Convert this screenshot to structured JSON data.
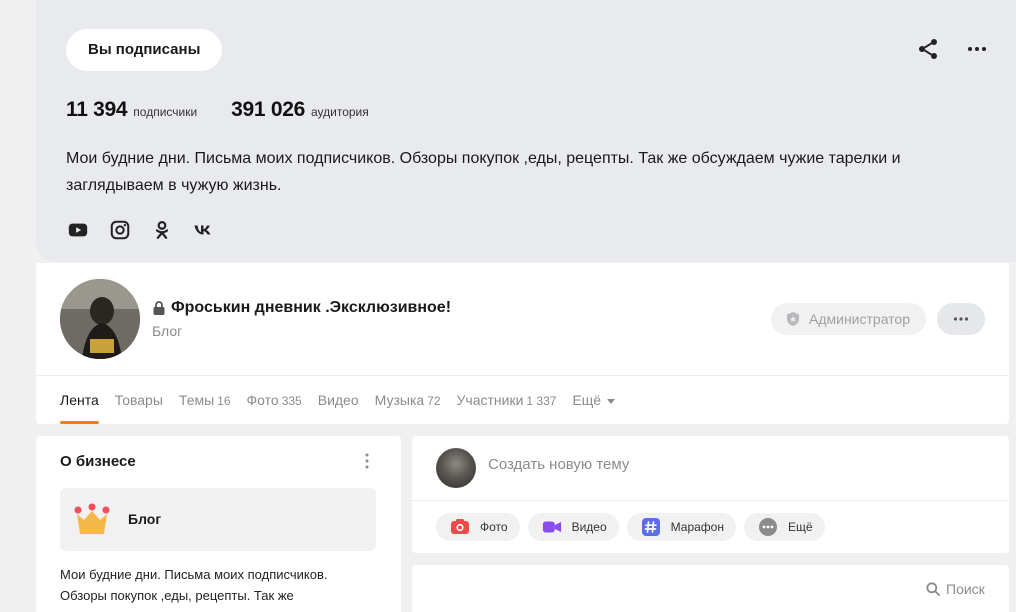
{
  "channel": {
    "subscribed_label": "Вы подписаны",
    "subscribers_count": "11 394",
    "subscribers_label": "подписчики",
    "audience_count": "391 026",
    "audience_label": "аудитория",
    "description": "Мои будние дни. Письма моих подписчиков. Обзоры покупок ,еды, рецепты. Так же обсуждаем чужие тарелки и заглядываем в чужую жизнь.",
    "socials": [
      "youtube-icon",
      "instagram-icon",
      "odnoklassniki-icon",
      "vk-icon"
    ]
  },
  "group": {
    "title": "Фроськин дневник .Эксклюзивное!",
    "subtitle": "Блог",
    "admin_label": "Администратор",
    "tabs": [
      {
        "label": "Лента",
        "count": ""
      },
      {
        "label": "Товары",
        "count": ""
      },
      {
        "label": "Темы",
        "count": "16"
      },
      {
        "label": "Фото",
        "count": "335"
      },
      {
        "label": "Видео",
        "count": ""
      },
      {
        "label": "Музыка",
        "count": "72"
      },
      {
        "label": "Участники",
        "count": "1 337"
      },
      {
        "label": "Ещё",
        "count": ""
      }
    ]
  },
  "about": {
    "title": "О бизнесе",
    "blog_label": "Блог",
    "text": "Мои будние дни. Письма моих подписчиков. Обзоры покупок ,еды, рецепты. Так же"
  },
  "create": {
    "placeholder": "Создать новую тему",
    "chips": [
      {
        "label": "Фото",
        "icon": "camera-icon",
        "color": "#ee4b4b"
      },
      {
        "label": "Видео",
        "icon": "video-camera-icon",
        "color": "#8a4cf0"
      },
      {
        "label": "Марафон",
        "icon": "hashtag-icon",
        "color": "#5b6ee8"
      },
      {
        "label": "Ещё",
        "icon": "more-dots-icon",
        "color": "#8b8b8b"
      }
    ]
  },
  "search": {
    "label": "Поиск"
  },
  "colors": {
    "accent": "#ee8208",
    "card_gray": "#e9eaee",
    "page_bg": "#f0f0f1"
  }
}
